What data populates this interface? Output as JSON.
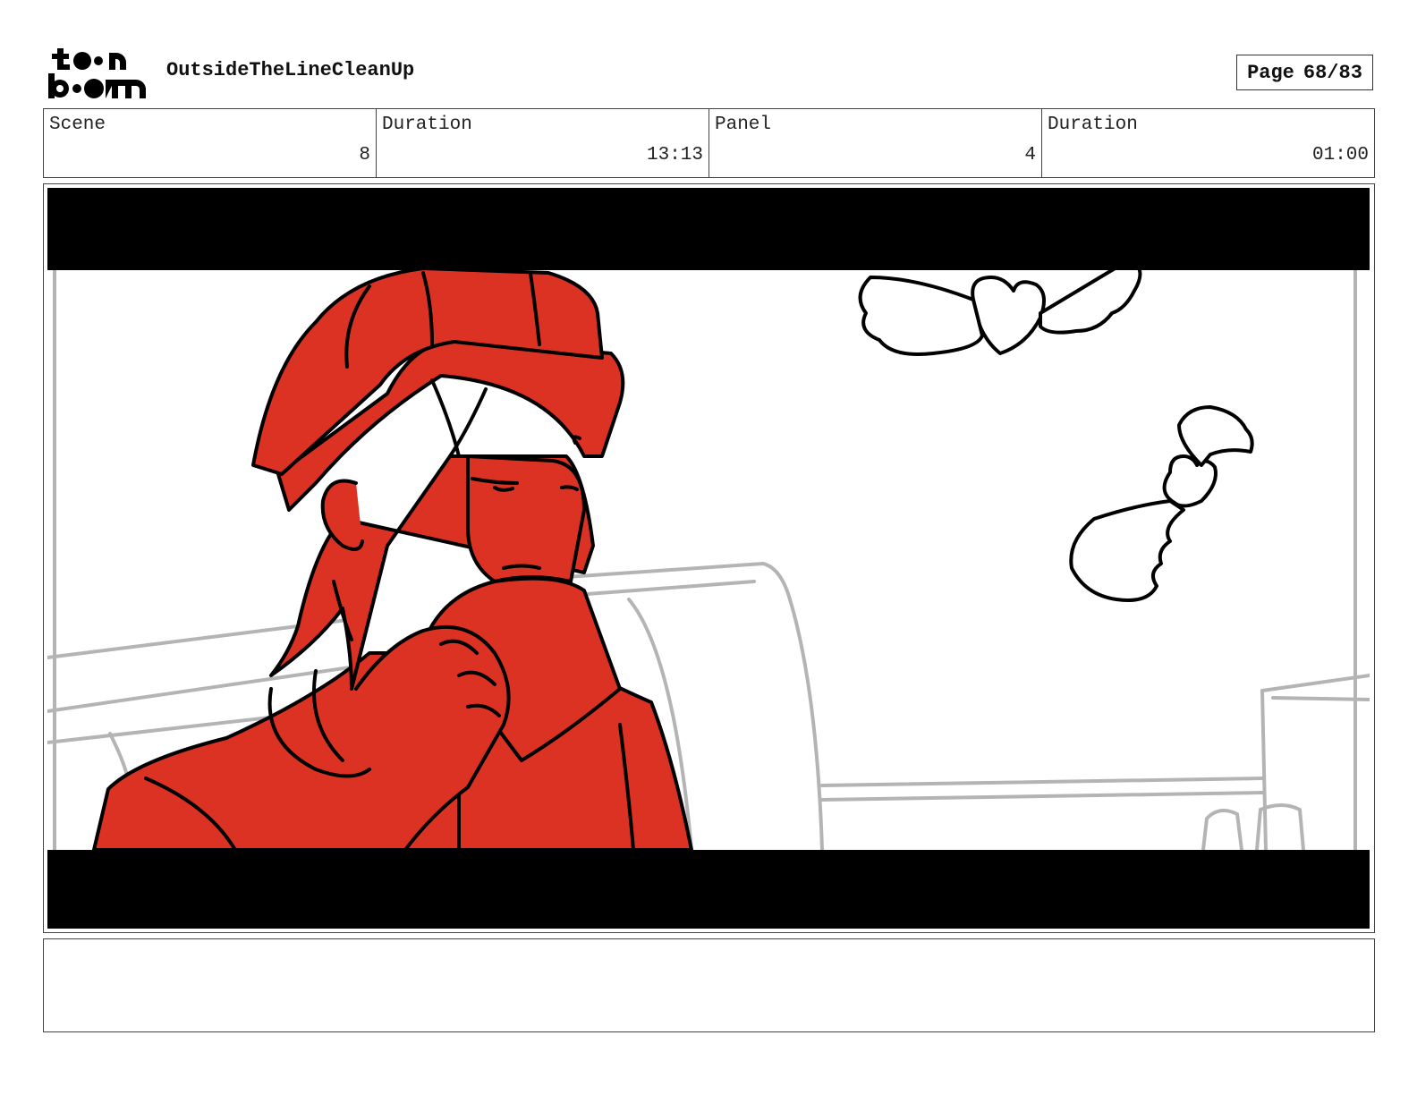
{
  "header": {
    "project_title": "OutsideTheLineCleanUp",
    "page_label": "Page",
    "page_number": "68/83"
  },
  "info": {
    "scene_label": "Scene",
    "scene_value": "8",
    "scene_duration_label": "Duration",
    "scene_duration_value": "13:13",
    "panel_label": "Panel",
    "panel_value": "4",
    "panel_duration_label": "Duration",
    "panel_duration_value": "01:00"
  },
  "notes": {
    "text": ""
  },
  "colors": {
    "character_fill": "#dc3224",
    "letterbox": "#000000",
    "background_lines": "#b4b4b4"
  }
}
